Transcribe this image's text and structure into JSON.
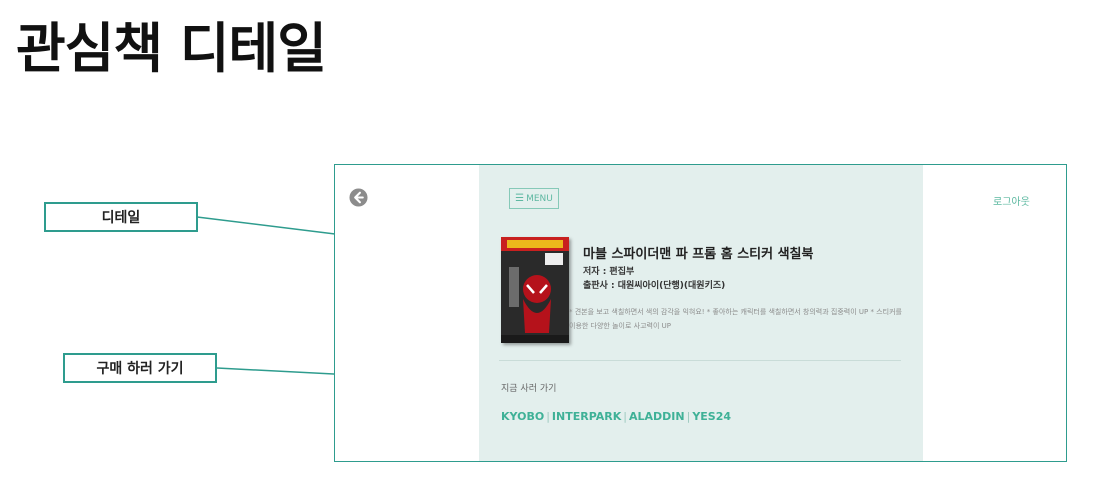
{
  "page": {
    "title": "관심책 디테일"
  },
  "callouts": {
    "detail": "디테일",
    "buy": "구매 하러 가기"
  },
  "screen": {
    "menu_label": "MENU",
    "logout_label": "로그아웃",
    "book": {
      "title": "마블 스파이더맨 파 프롬 홈 스티커 색칠북",
      "author": "저자 : 편집부",
      "publisher": "출판사 : 대원씨아이(단행)(대원키즈)",
      "description": "* 견본을 보고 색칠하면서 색의 감각을 익혀요! * 좋아하는 캐릭터를 색칠하면서 창의력과 집중력이 UP * 스티커를 이용한 다양한 놀이로 사고력이 UP"
    },
    "buy_heading": "지금 사러 가기",
    "stores": [
      {
        "label": "KYOBO"
      },
      {
        "label": "INTERPARK"
      },
      {
        "label": "ALADDIN"
      },
      {
        "label": "YES24"
      }
    ],
    "store_separator": "|"
  },
  "colors": {
    "accent": "#2e9c8e",
    "panel": "#e3efed",
    "link": "#3fb197"
  },
  "icons": {
    "back": "back-arrow-circle-icon",
    "menu": "menu-lines-icon"
  }
}
